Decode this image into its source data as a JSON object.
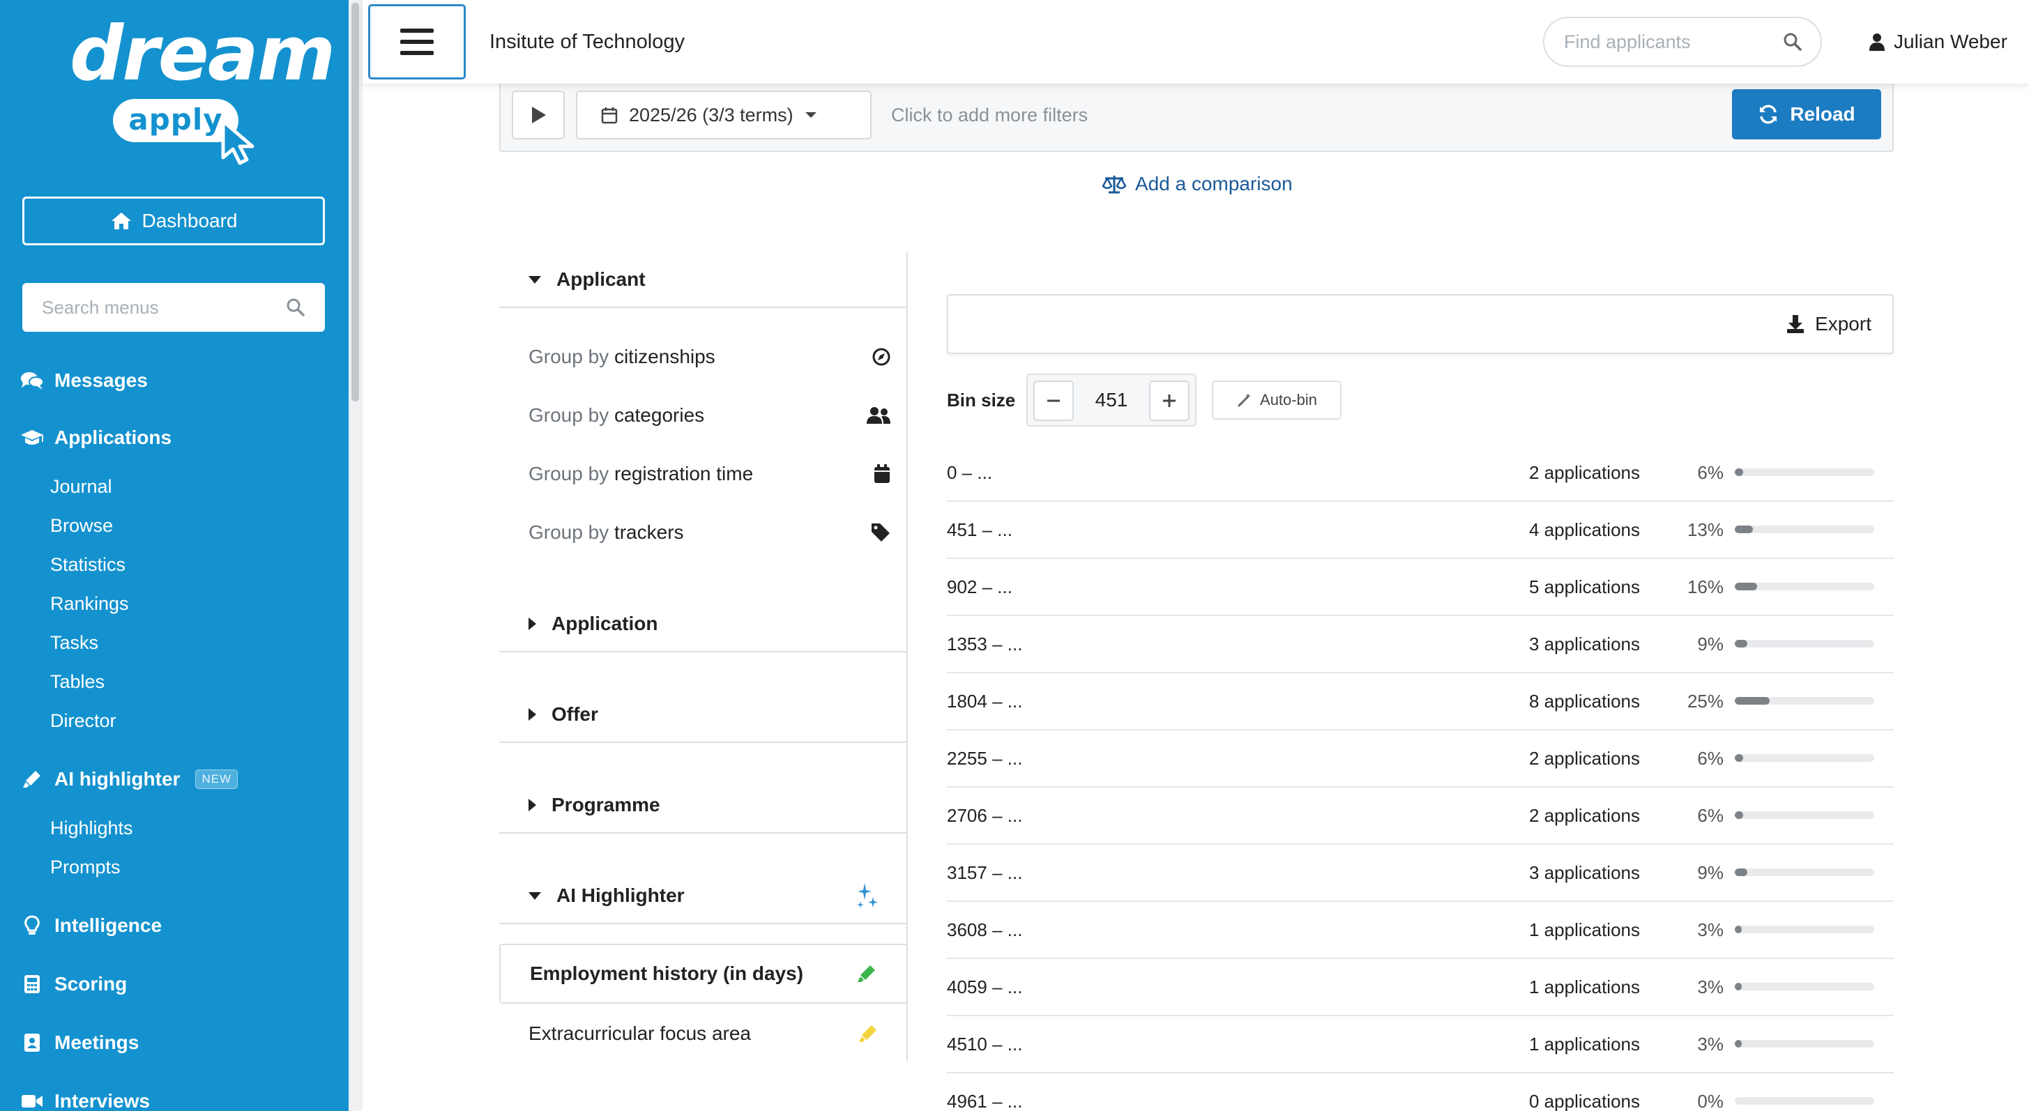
{
  "brand": {
    "word": "dream",
    "pill": "apply"
  },
  "sidebar": {
    "dashboard_label": "Dashboard",
    "search_placeholder": "Search menus",
    "messages": "Messages",
    "applications": "Applications",
    "applications_items": [
      "Journal",
      "Browse",
      "Statistics",
      "Rankings",
      "Tasks",
      "Tables",
      "Director"
    ],
    "ai_highlighter": "AI highlighter",
    "ai_badge": "NEW",
    "ai_items": [
      "Highlights",
      "Prompts"
    ],
    "intelligence": "Intelligence",
    "scoring": "Scoring",
    "meetings": "Meetings",
    "interviews": "Interviews"
  },
  "header": {
    "institution": "Insitute of Technology",
    "find_placeholder": "Find applicants",
    "user_name": "Julian Weber"
  },
  "filters": {
    "term": "2025/26 (3/3 terms)",
    "more_filters": "Click to add more filters",
    "reload": "Reload",
    "add_comparison": "Add a comparison"
  },
  "groups": {
    "applicant_title": "Applicant",
    "prefix": "Group by",
    "items": [
      {
        "key": "citizenships",
        "icon": "compass-icon"
      },
      {
        "key": "categories",
        "icon": "users-icon"
      },
      {
        "key": "registration time",
        "icon": "calendar-icon"
      },
      {
        "key": "trackers",
        "icon": "tag-icon"
      }
    ],
    "application_title": "Application",
    "offer_title": "Offer",
    "programme_title": "Programme",
    "ai_title": "AI Highlighter",
    "ai_fields": [
      {
        "label": "Employment history (in days)",
        "color": "#3bb54a"
      },
      {
        "label": "Extracurricular focus area",
        "color": "#f5d33c"
      }
    ]
  },
  "results": {
    "export": "Export",
    "bin_label": "Bin size",
    "bin_value": "451",
    "auto_bin": "Auto-bin",
    "rows": [
      {
        "range": "0 – ...",
        "count": "2 applications",
        "pct": "6%",
        "value": 6
      },
      {
        "range": "451 – ...",
        "count": "4 applications",
        "pct": "13%",
        "value": 13
      },
      {
        "range": "902 – ...",
        "count": "5 applications",
        "pct": "16%",
        "value": 16
      },
      {
        "range": "1353 – ...",
        "count": "3 applications",
        "pct": "9%",
        "value": 9
      },
      {
        "range": "1804 – ...",
        "count": "8 applications",
        "pct": "25%",
        "value": 25
      },
      {
        "range": "2255 – ...",
        "count": "2 applications",
        "pct": "6%",
        "value": 6
      },
      {
        "range": "2706 – ...",
        "count": "2 applications",
        "pct": "6%",
        "value": 6
      },
      {
        "range": "3157 – ...",
        "count": "3 applications",
        "pct": "9%",
        "value": 9
      },
      {
        "range": "3608 – ...",
        "count": "1 applications",
        "pct": "3%",
        "value": 3
      },
      {
        "range": "4059 – ...",
        "count": "1 applications",
        "pct": "3%",
        "value": 3
      },
      {
        "range": "4510 – ...",
        "count": "1 applications",
        "pct": "3%",
        "value": 3
      },
      {
        "range": "4961 – ...",
        "count": "0 applications",
        "pct": "0%",
        "value": 0
      }
    ]
  },
  "colors": {
    "sidebar": "#1492cf",
    "primary": "#1c7cc1",
    "link": "#1a5a9a",
    "bar": "#7d8287"
  }
}
